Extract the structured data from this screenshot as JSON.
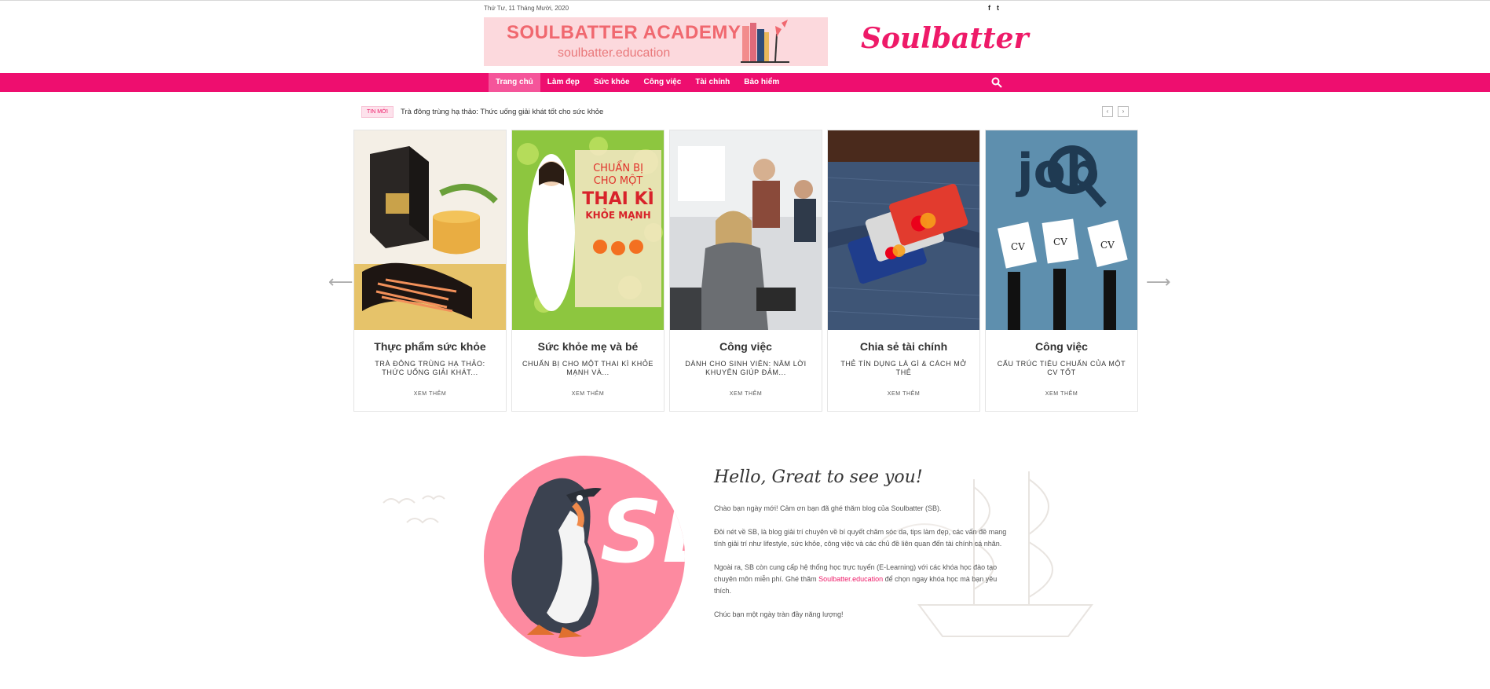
{
  "topbar": {
    "date": "Thứ Tư, 11 Tháng Mười, 2020",
    "social": [
      "f",
      "t"
    ]
  },
  "banner": {
    "title": "SOULBATTER ACADEMY",
    "url": "soulbatter.education"
  },
  "brand": {
    "name": "Soulbatter"
  },
  "nav": {
    "items": [
      {
        "label": "Trang chủ",
        "active": true
      },
      {
        "label": "Làm đẹp"
      },
      {
        "label": "Sức khỏe"
      },
      {
        "label": "Công việc"
      },
      {
        "label": "Tài chính"
      },
      {
        "label": "Bảo hiểm"
      }
    ],
    "search_icon": "search-icon"
  },
  "ticker": {
    "tag": "TIN MỚI",
    "headline": "Trà đông trùng hạ thảo: Thức uống giải khát tốt cho sức khỏe",
    "prev": "‹",
    "next": "›"
  },
  "slider": {
    "prev": "⟵",
    "next": "⟶",
    "cards": [
      {
        "category": "Thực phẩm sức khỏe",
        "excerpt": "TRÀ ĐÔNG TRÙNG HẠ THẢO: THỨC UỐNG GIẢI KHÁT...",
        "more": "XEM THÊM"
      },
      {
        "category": "Sức khỏe mẹ và bé",
        "excerpt": "CHUẨN BỊ CHO MỘT THAI KÌ KHỎE MẠNH VÀ...",
        "more": "XEM THÊM"
      },
      {
        "category": "Công việc",
        "excerpt": "DÀNH CHO SINH VIÊN: NĂM LỜI KHUYÊN GIÚP ĐẢM...",
        "more": "XEM THÊM"
      },
      {
        "category": "Chia sẻ tài chính",
        "excerpt": "THẺ TÍN DỤNG LÀ GÌ & CÁCH MỞ THẺ",
        "more": "XEM THÊM"
      },
      {
        "category": "Công việc",
        "excerpt": "CẤU TRÚC TIÊU CHUẨN CỦA MỘT CV TỐT",
        "more": "XEM THÊM"
      }
    ],
    "card2_cover": {
      "line1": "CHUẨN BỊ",
      "line2": "CHO MỘT",
      "line3": "THAI KÌ",
      "line4": "KHỎE MẠNH"
    },
    "card5_cv": "CV",
    "card5_job": "job"
  },
  "hello": {
    "title": "Hello, Great to see you!",
    "p1": "Chào bạn ngày mới! Cảm ơn bạn đã ghé thăm blog của Soulbatter (SB).",
    "p2": "Đôi nét về SB, là blog giải trí chuyên về bí quyết chăm sóc da, tips làm đẹp, các vấn đề mang tính giải trí như lifestyle, sức khỏe, công việc và các chủ đề liên quan đến tài chính cá nhân.",
    "p3_before": "Ngoài ra, SB còn cung cấp hệ thống học trực tuyến (E-Learning) với các khóa học đào tạo chuyên môn miễn phí. Ghé thăm ",
    "p3_link": "Soulbatter.education",
    "p3_after": " để chọn ngay khóa học mà bạn yêu thích.",
    "p4": "Chúc bạn một ngày tràn đầy năng lượng!",
    "logo_text": "SB"
  },
  "colors": {
    "accent": "#ee0e6f",
    "brand": "#ee1a68",
    "banner_bg": "#fcd9dd",
    "circle": "#fd8aa0"
  }
}
